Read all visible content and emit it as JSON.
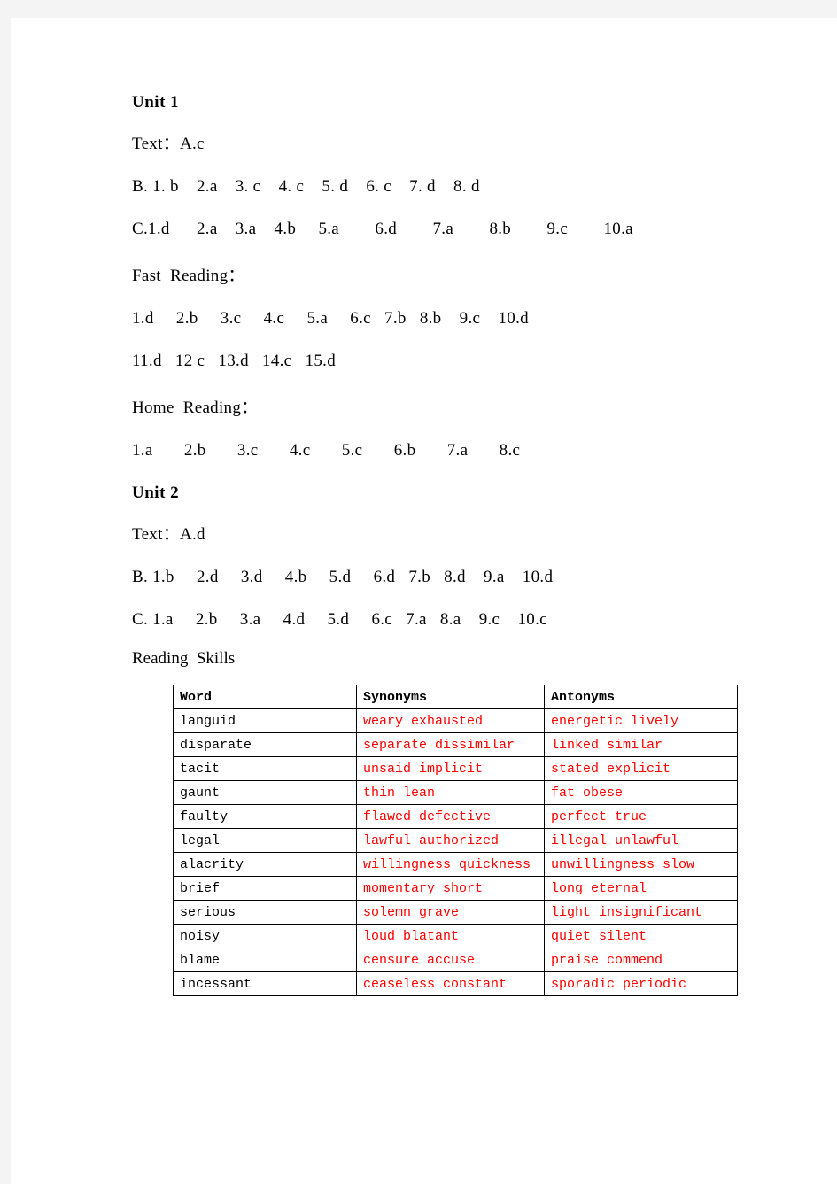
{
  "document": {
    "units": [
      {
        "heading": "Unit 1",
        "lines": [
          {
            "name": "text-answer-line",
            "text": "Text：A.c"
          },
          {
            "name": "section-b-line",
            "text": "B. 1. b    2.a    3. c    4. c    5. d    6. c    7. d    8. d"
          },
          {
            "name": "section-c-line",
            "text": "C.1.d      2.a    3.a    4.b     5.a        6.d        7.a        8.b        9.c        10.a"
          },
          {
            "name": "fast-reading-label",
            "text": "Fast  Reading："
          },
          {
            "name": "fast-reading-answers-1",
            "text": "1.d     2.b     3.c     4.c     5.a     6.c   7.b   8.b    9.c    10.d"
          },
          {
            "name": "fast-reading-answers-2",
            "text": "11.d   12 c   13.d   14.c   15.d"
          },
          {
            "name": "home-reading-label",
            "text": "Home  Reading："
          },
          {
            "name": "home-reading-answers",
            "text": "1.a       2.b       3.c       4.c       5.c       6.b       7.a       8.c"
          }
        ]
      },
      {
        "heading": "Unit 2",
        "lines": [
          {
            "name": "text-answer-line",
            "text": "Text：A.d"
          },
          {
            "name": "section-b-line",
            "text": "B. 1.b     2.d     3.d     4.b     5.d     6.d   7.b   8.d    9.a    10.d"
          },
          {
            "name": "section-c-line",
            "text": "C. 1.a     2.b     3.a     4.d     5.d     6.c   7.a   8.a    9.c    10.c"
          }
        ],
        "reading_skills_label": "Reading  Skills"
      }
    ],
    "skills_table": {
      "headers": [
        "Word",
        "Synonyms",
        "Antonyms"
      ],
      "rows": [
        {
          "word": "languid",
          "synonyms": "weary exhausted",
          "antonyms": "energetic lively"
        },
        {
          "word": "disparate",
          "synonyms": "separate dissimilar",
          "antonyms": "linked similar"
        },
        {
          "word": "tacit",
          "synonyms": "unsaid implicit",
          "antonyms": "stated explicit"
        },
        {
          "word": "gaunt",
          "synonyms": "thin lean",
          "antonyms": "fat obese"
        },
        {
          "word": "faulty",
          "synonyms": "flawed defective",
          "antonyms": "perfect true"
        },
        {
          "word": "legal",
          "synonyms": "lawful authorized",
          "antonyms": "illegal unlawful"
        },
        {
          "word": "alacrity",
          "synonyms": "willingness quickness",
          "antonyms": "unwillingness slow"
        },
        {
          "word": "brief",
          "synonyms": "momentary short",
          "antonyms": "long eternal"
        },
        {
          "word": "serious",
          "synonyms": "solemn grave",
          "antonyms": "light insignificant"
        },
        {
          "word": "noisy",
          "synonyms": "loud blatant",
          "antonyms": "quiet silent"
        },
        {
          "word": "blame",
          "synonyms": "censure accuse",
          "antonyms": "praise commend"
        },
        {
          "word": "incessant",
          "synonyms": "ceaseless constant",
          "antonyms": "sporadic periodic"
        }
      ]
    },
    "colors": {
      "answer_text": "#000000",
      "synonym_antonym_text": "#FF0000",
      "page_background": "#FFFFFF",
      "canvas_background": "#F4F4F4"
    }
  }
}
